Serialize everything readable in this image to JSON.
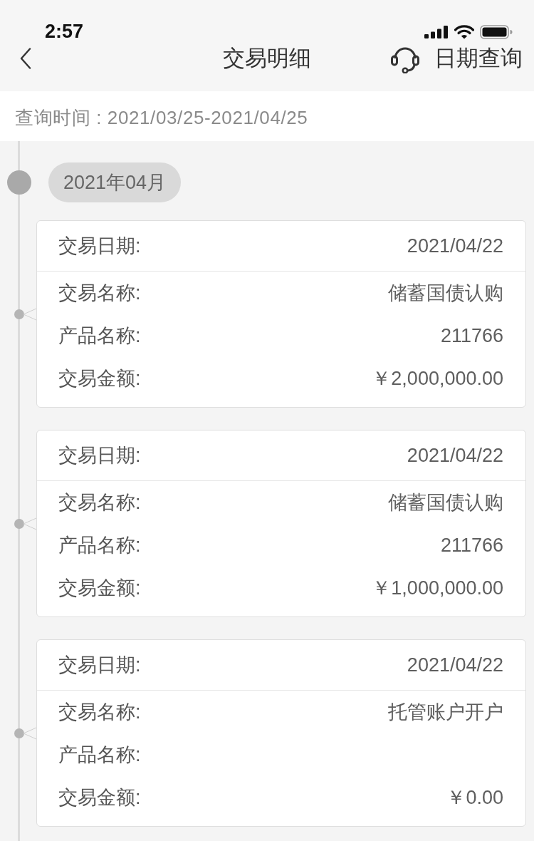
{
  "status_bar": {
    "time": "2:57"
  },
  "nav_bar": {
    "title": "交易明细",
    "action": "日期查询"
  },
  "query_bar": {
    "text": "查询时间 : 2021/03/25-2021/04/25"
  },
  "timeline": {
    "month": "2021年04月",
    "records": [
      {
        "fields": [
          {
            "label": "交易日期:",
            "value": "2021/04/22"
          },
          {
            "label": "交易名称:",
            "value": "储蓄国债认购"
          },
          {
            "label": "产品名称:",
            "value": "211766"
          },
          {
            "label": "交易金额:",
            "value": "￥2,000,000.00"
          }
        ]
      },
      {
        "fields": [
          {
            "label": "交易日期:",
            "value": "2021/04/22"
          },
          {
            "label": "交易名称:",
            "value": "储蓄国债认购"
          },
          {
            "label": "产品名称:",
            "value": "211766"
          },
          {
            "label": "交易金额:",
            "value": "￥1,000,000.00"
          }
        ]
      },
      {
        "fields": [
          {
            "label": "交易日期:",
            "value": "2021/04/22"
          },
          {
            "label": "交易名称:",
            "value": "托管账户开户"
          },
          {
            "label": "产品名称:"
          },
          {
            "label": "交易金额:",
            "value": "￥0.00"
          }
        ]
      }
    ]
  }
}
